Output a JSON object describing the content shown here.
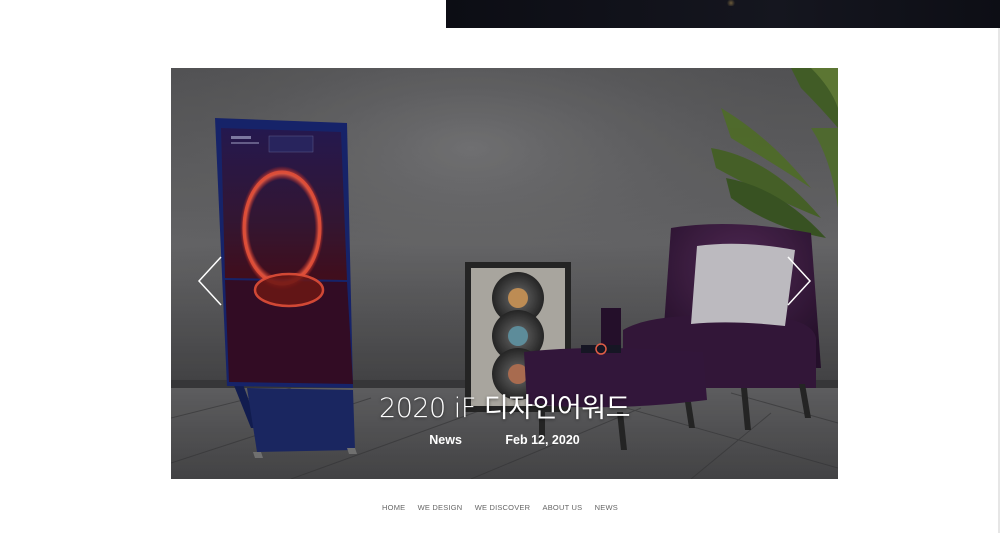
{
  "slide": {
    "title": "2020 iF 디자인어워드",
    "category": "News",
    "date": "Feb 12, 2020"
  },
  "footer": {
    "nav": [
      "HOME",
      "WE DESIGN",
      "WE DISCOVER",
      "ABOUT US",
      "NEWS"
    ]
  },
  "colors": {
    "background": "#ffffff",
    "banner": "#0e0f16",
    "caption_text": "#ffffff",
    "nav_text": "#666666"
  },
  "icons": {
    "prev": "chevron-left-icon",
    "next": "chevron-right-icon"
  }
}
